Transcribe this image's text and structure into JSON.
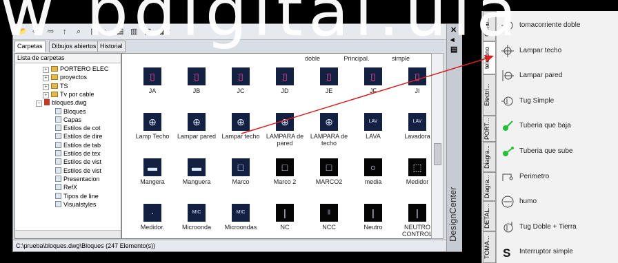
{
  "toolbar": {
    "back": "⇦",
    "fwd": "⇨",
    "up": "↑"
  },
  "tabs": [
    "Carpetas",
    "Dibujos abiertos",
    "Historial"
  ],
  "tree": {
    "header": "Lista de carpetas",
    "items": [
      {
        "label": "PORTERO ELEC",
        "type": "folder"
      },
      {
        "label": "proyectos",
        "type": "folder"
      },
      {
        "label": "TS",
        "type": "folder"
      },
      {
        "label": "Tv por cable",
        "type": "folder"
      },
      {
        "label": "bloques.dwg",
        "type": "dwg"
      },
      {
        "label": "Bloques",
        "type": "item"
      },
      {
        "label": "Capas",
        "type": "item"
      },
      {
        "label": "Estilos de cot",
        "type": "item"
      },
      {
        "label": "Estilos de dire",
        "type": "item"
      },
      {
        "label": "Estilos de tab",
        "type": "item"
      },
      {
        "label": "Estilos de tex",
        "type": "item"
      },
      {
        "label": "Estilos de vist",
        "type": "item"
      },
      {
        "label": "Estilos de vist",
        "type": "item"
      },
      {
        "label": "Presentacion",
        "type": "item"
      },
      {
        "label": "RefX",
        "type": "item"
      },
      {
        "label": "Tipos de line",
        "type": "item"
      },
      {
        "label": "Visualstyles",
        "type": "item"
      }
    ]
  },
  "toplabels": [
    "doble",
    "Principal.",
    "simple"
  ],
  "grid": [
    [
      {
        "label": "JA"
      },
      {
        "label": "JB"
      },
      {
        "label": "JC"
      },
      {
        "label": "JD"
      },
      {
        "label": "JE"
      },
      {
        "label": "JF"
      },
      {
        "label": "JI"
      }
    ],
    [
      {
        "label": "Lamp Techo"
      },
      {
        "label": "Lampar pared"
      },
      {
        "label": "Lampar techo"
      },
      {
        "label": "LAMPARA de pared"
      },
      {
        "label": "LAMPARA de techo"
      },
      {
        "label": "LAVA"
      },
      {
        "label": "Lavadora"
      }
    ],
    [
      {
        "label": "Mangera"
      },
      {
        "label": "Manguera"
      },
      {
        "label": "Marco"
      },
      {
        "label": "Marco 2"
      },
      {
        "label": "MARCO2"
      },
      {
        "label": "media"
      },
      {
        "label": "Medidor"
      }
    ],
    [
      {
        "label": "Medidor."
      },
      {
        "label": "Microonda"
      },
      {
        "label": "Microondas"
      },
      {
        "label": "NC"
      },
      {
        "label": "NCC"
      },
      {
        "label": "Neutro"
      },
      {
        "label": "NEUTRO CONTROL"
      }
    ]
  ],
  "status": "C:\\prueba\\bloques.dwg\\Bloques (247 Elemento(s))",
  "side_title": "DesignCenter",
  "watermark": "w bdigital.uia",
  "palette": {
    "tabs": [
      "Contr...",
      "telefono",
      "Electri...",
      "PORT...",
      "Diagra...",
      "Diagra...",
      "DETAL...",
      "TOMA..."
    ],
    "items": [
      {
        "label": "tomacorriente doble",
        "icon": "outlet-icon"
      },
      {
        "label": "Lampar techo",
        "icon": "ceiling-lamp-icon"
      },
      {
        "label": "Lampar pared",
        "icon": "wall-lamp-icon"
      },
      {
        "label": "Tug Simple",
        "icon": "outlet-icon"
      },
      {
        "label": "Tuberia que baja",
        "icon": "pipe-down-icon"
      },
      {
        "label": "Tuberia que sube",
        "icon": "pipe-up-icon"
      },
      {
        "label": "Perimetro",
        "icon": "perimeter-icon"
      },
      {
        "label": "humo",
        "icon": "smoke-icon"
      },
      {
        "label": "Tug Doble + Tierra",
        "icon": "outlet-ground-icon"
      },
      {
        "label": "Interruptor simple",
        "icon": "switch-icon"
      }
    ]
  },
  "colors": {
    "arrow": "#d42020",
    "thumb_bg": "#142042",
    "accent": "#22c037"
  }
}
